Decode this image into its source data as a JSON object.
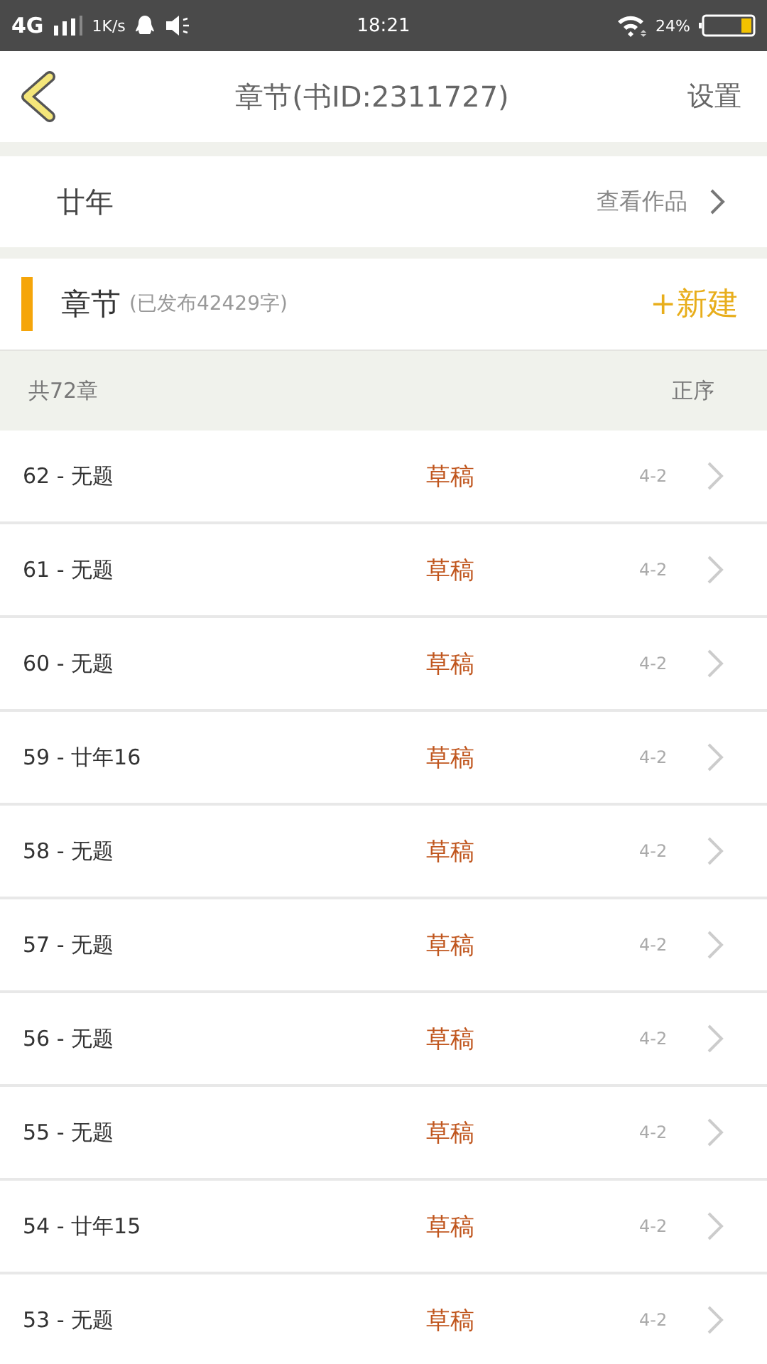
{
  "status_bar": {
    "network": "4G",
    "speed": "1K/s",
    "time": "18:21",
    "battery": "24%"
  },
  "nav": {
    "title": "章节(书ID:2311727)",
    "action": "设置"
  },
  "book": {
    "title": "廿年",
    "link": "查看作品"
  },
  "section": {
    "title": "章节",
    "subtitle": "(已发布42429字)",
    "action": "+新建"
  },
  "list_header": {
    "count": "共72章",
    "order": "正序"
  },
  "chapters": [
    {
      "title": "62 - 无题",
      "status": "草稿",
      "date": "4-2"
    },
    {
      "title": "61 - 无题",
      "status": "草稿",
      "date": "4-2"
    },
    {
      "title": "60 - 无题",
      "status": "草稿",
      "date": "4-2"
    },
    {
      "title": "59 - 廿年16",
      "status": "草稿",
      "date": "4-2"
    },
    {
      "title": "58 - 无题",
      "status": "草稿",
      "date": "4-2"
    },
    {
      "title": "57 - 无题",
      "status": "草稿",
      "date": "4-2"
    },
    {
      "title": "56 - 无题",
      "status": "草稿",
      "date": "4-2"
    },
    {
      "title": "55 - 无题",
      "status": "草稿",
      "date": "4-2"
    },
    {
      "title": "54 - 廿年15",
      "status": "草稿",
      "date": "4-2"
    },
    {
      "title": "53 - 无题",
      "status": "草稿",
      "date": "4-2"
    }
  ]
}
